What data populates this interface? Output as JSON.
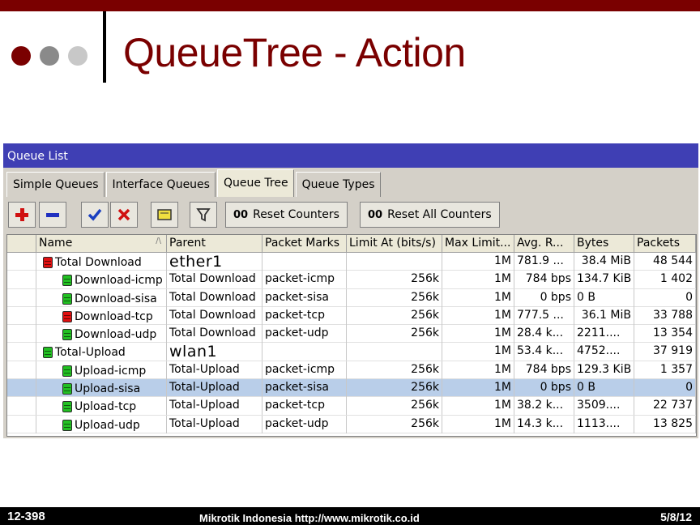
{
  "slide": {
    "title": "QueueTree - Action",
    "footer_left": "12-398",
    "footer_center": "Mikrotik Indonesia http://www.mikrotik.co.id",
    "footer_right": "5/8/12",
    "accent_color": "#7a0000"
  },
  "window": {
    "title": "Queue List",
    "tabs": [
      {
        "label": "Simple Queues",
        "active": false
      },
      {
        "label": "Interface Queues",
        "active": false
      },
      {
        "label": "Queue Tree",
        "active": true
      },
      {
        "label": "Queue Types",
        "active": false
      }
    ],
    "toolbar": {
      "add_icon": "plus-icon",
      "remove_icon": "minus-icon",
      "enable_icon": "check-icon",
      "disable_icon": "x-icon",
      "comment_icon": "note-icon",
      "filter_icon": "funnel-icon",
      "reset_counters_prefix": "00",
      "reset_counters_label": "Reset Counters",
      "reset_all_prefix": "00",
      "reset_all_label": "Reset All Counters"
    },
    "columns": [
      "Name",
      "Parent",
      "Packet Marks",
      "Limit At (bits/s)",
      "Max Limit...",
      "Avg. R...",
      "Bytes",
      "Packets"
    ],
    "rows": [
      {
        "name": "Total Download",
        "parent": "ether1",
        "marks": "",
        "limit_at": "",
        "max_limit": "1M",
        "avg_rate": "781.9 ...",
        "bytes": "38.4 MiB",
        "packets": "48 544",
        "icon_color": "#e01010",
        "indent": 0,
        "parent_big": true
      },
      {
        "name": "Download-icmp",
        "parent": "Total Download",
        "marks": "packet-icmp",
        "limit_at": "256k",
        "max_limit": "1M",
        "avg_rate": "784 bps",
        "bytes": "134.7 KiB",
        "packets": "1 402",
        "icon_color": "#22c022",
        "indent": 1
      },
      {
        "name": "Download-sisa",
        "parent": "Total Download",
        "marks": "packet-sisa",
        "limit_at": "256k",
        "max_limit": "1M",
        "avg_rate": "0 bps",
        "bytes": "0 B",
        "packets": "0",
        "icon_color": "#22c022",
        "indent": 1
      },
      {
        "name": "Download-tcp",
        "parent": "Total Download",
        "marks": "packet-tcp",
        "limit_at": "256k",
        "max_limit": "1M",
        "avg_rate": "777.5 ...",
        "bytes": "36.1 MiB",
        "packets": "33 788",
        "icon_color": "#e01010",
        "indent": 1
      },
      {
        "name": "Download-udp",
        "parent": "Total Download",
        "marks": "packet-udp",
        "limit_at": "256k",
        "max_limit": "1M",
        "avg_rate": "28.4 k...",
        "bytes": "2211....",
        "packets": "13 354",
        "icon_color": "#22c022",
        "indent": 1
      },
      {
        "name": "Total-Upload",
        "parent": "wlan1",
        "marks": "",
        "limit_at": "",
        "max_limit": "1M",
        "avg_rate": "53.4 k...",
        "bytes": "4752....",
        "packets": "37 919",
        "icon_color": "#22c022",
        "indent": 0,
        "parent_big": true
      },
      {
        "name": "Upload-icmp",
        "parent": "Total-Upload",
        "marks": "packet-icmp",
        "limit_at": "256k",
        "max_limit": "1M",
        "avg_rate": "784 bps",
        "bytes": "129.3 KiB",
        "packets": "1 357",
        "icon_color": "#22c022",
        "indent": 1
      },
      {
        "name": "Upload-sisa",
        "parent": "Total-Upload",
        "marks": "packet-sisa",
        "limit_at": "256k",
        "max_limit": "1M",
        "avg_rate": "0 bps",
        "bytes": "0 B",
        "packets": "0",
        "icon_color": "#22c022",
        "indent": 1,
        "selected": true
      },
      {
        "name": "Upload-tcp",
        "parent": "Total-Upload",
        "marks": "packet-tcp",
        "limit_at": "256k",
        "max_limit": "1M",
        "avg_rate": "38.2 k...",
        "bytes": "3509....",
        "packets": "22 737",
        "icon_color": "#22c022",
        "indent": 1
      },
      {
        "name": "Upload-udp",
        "parent": "Total-Upload",
        "marks": "packet-udp",
        "limit_at": "256k",
        "max_limit": "1M",
        "avg_rate": "14.3 k...",
        "bytes": "1113....",
        "packets": "13 825",
        "icon_color": "#22c022",
        "indent": 1
      }
    ]
  }
}
